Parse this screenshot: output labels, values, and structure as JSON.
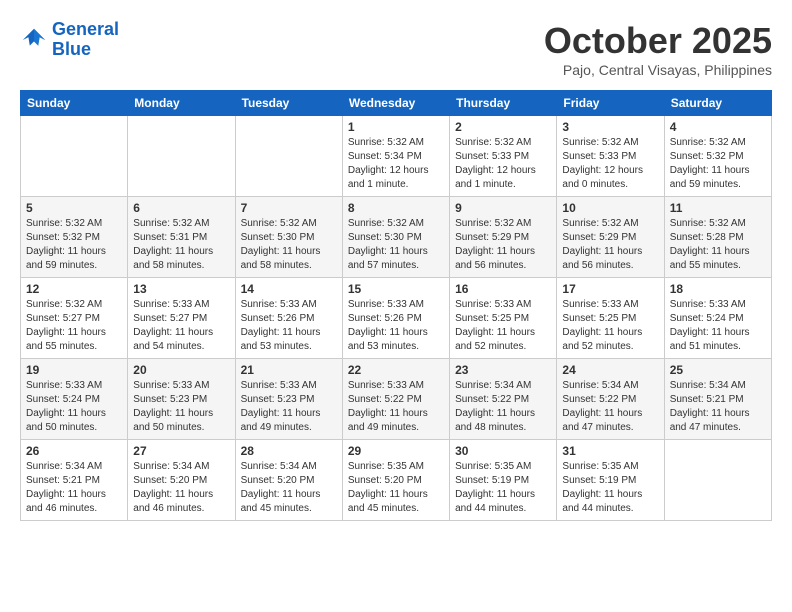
{
  "header": {
    "logo_line1": "General",
    "logo_line2": "Blue",
    "title": "October 2025",
    "location": "Pajo, Central Visayas, Philippines"
  },
  "weekdays": [
    "Sunday",
    "Monday",
    "Tuesday",
    "Wednesday",
    "Thursday",
    "Friday",
    "Saturday"
  ],
  "weeks": [
    [
      {
        "day": "",
        "info": ""
      },
      {
        "day": "",
        "info": ""
      },
      {
        "day": "",
        "info": ""
      },
      {
        "day": "1",
        "info": "Sunrise: 5:32 AM\nSunset: 5:34 PM\nDaylight: 12 hours\nand 1 minute."
      },
      {
        "day": "2",
        "info": "Sunrise: 5:32 AM\nSunset: 5:33 PM\nDaylight: 12 hours\nand 1 minute."
      },
      {
        "day": "3",
        "info": "Sunrise: 5:32 AM\nSunset: 5:33 PM\nDaylight: 12 hours\nand 0 minutes."
      },
      {
        "day": "4",
        "info": "Sunrise: 5:32 AM\nSunset: 5:32 PM\nDaylight: 11 hours\nand 59 minutes."
      }
    ],
    [
      {
        "day": "5",
        "info": "Sunrise: 5:32 AM\nSunset: 5:32 PM\nDaylight: 11 hours\nand 59 minutes."
      },
      {
        "day": "6",
        "info": "Sunrise: 5:32 AM\nSunset: 5:31 PM\nDaylight: 11 hours\nand 58 minutes."
      },
      {
        "day": "7",
        "info": "Sunrise: 5:32 AM\nSunset: 5:30 PM\nDaylight: 11 hours\nand 58 minutes."
      },
      {
        "day": "8",
        "info": "Sunrise: 5:32 AM\nSunset: 5:30 PM\nDaylight: 11 hours\nand 57 minutes."
      },
      {
        "day": "9",
        "info": "Sunrise: 5:32 AM\nSunset: 5:29 PM\nDaylight: 11 hours\nand 56 minutes."
      },
      {
        "day": "10",
        "info": "Sunrise: 5:32 AM\nSunset: 5:29 PM\nDaylight: 11 hours\nand 56 minutes."
      },
      {
        "day": "11",
        "info": "Sunrise: 5:32 AM\nSunset: 5:28 PM\nDaylight: 11 hours\nand 55 minutes."
      }
    ],
    [
      {
        "day": "12",
        "info": "Sunrise: 5:32 AM\nSunset: 5:27 PM\nDaylight: 11 hours\nand 55 minutes."
      },
      {
        "day": "13",
        "info": "Sunrise: 5:33 AM\nSunset: 5:27 PM\nDaylight: 11 hours\nand 54 minutes."
      },
      {
        "day": "14",
        "info": "Sunrise: 5:33 AM\nSunset: 5:26 PM\nDaylight: 11 hours\nand 53 minutes."
      },
      {
        "day": "15",
        "info": "Sunrise: 5:33 AM\nSunset: 5:26 PM\nDaylight: 11 hours\nand 53 minutes."
      },
      {
        "day": "16",
        "info": "Sunrise: 5:33 AM\nSunset: 5:25 PM\nDaylight: 11 hours\nand 52 minutes."
      },
      {
        "day": "17",
        "info": "Sunrise: 5:33 AM\nSunset: 5:25 PM\nDaylight: 11 hours\nand 52 minutes."
      },
      {
        "day": "18",
        "info": "Sunrise: 5:33 AM\nSunset: 5:24 PM\nDaylight: 11 hours\nand 51 minutes."
      }
    ],
    [
      {
        "day": "19",
        "info": "Sunrise: 5:33 AM\nSunset: 5:24 PM\nDaylight: 11 hours\nand 50 minutes."
      },
      {
        "day": "20",
        "info": "Sunrise: 5:33 AM\nSunset: 5:23 PM\nDaylight: 11 hours\nand 50 minutes."
      },
      {
        "day": "21",
        "info": "Sunrise: 5:33 AM\nSunset: 5:23 PM\nDaylight: 11 hours\nand 49 minutes."
      },
      {
        "day": "22",
        "info": "Sunrise: 5:33 AM\nSunset: 5:22 PM\nDaylight: 11 hours\nand 49 minutes."
      },
      {
        "day": "23",
        "info": "Sunrise: 5:34 AM\nSunset: 5:22 PM\nDaylight: 11 hours\nand 48 minutes."
      },
      {
        "day": "24",
        "info": "Sunrise: 5:34 AM\nSunset: 5:22 PM\nDaylight: 11 hours\nand 47 minutes."
      },
      {
        "day": "25",
        "info": "Sunrise: 5:34 AM\nSunset: 5:21 PM\nDaylight: 11 hours\nand 47 minutes."
      }
    ],
    [
      {
        "day": "26",
        "info": "Sunrise: 5:34 AM\nSunset: 5:21 PM\nDaylight: 11 hours\nand 46 minutes."
      },
      {
        "day": "27",
        "info": "Sunrise: 5:34 AM\nSunset: 5:20 PM\nDaylight: 11 hours\nand 46 minutes."
      },
      {
        "day": "28",
        "info": "Sunrise: 5:34 AM\nSunset: 5:20 PM\nDaylight: 11 hours\nand 45 minutes."
      },
      {
        "day": "29",
        "info": "Sunrise: 5:35 AM\nSunset: 5:20 PM\nDaylight: 11 hours\nand 45 minutes."
      },
      {
        "day": "30",
        "info": "Sunrise: 5:35 AM\nSunset: 5:19 PM\nDaylight: 11 hours\nand 44 minutes."
      },
      {
        "day": "31",
        "info": "Sunrise: 5:35 AM\nSunset: 5:19 PM\nDaylight: 11 hours\nand 44 minutes."
      },
      {
        "day": "",
        "info": ""
      }
    ]
  ]
}
